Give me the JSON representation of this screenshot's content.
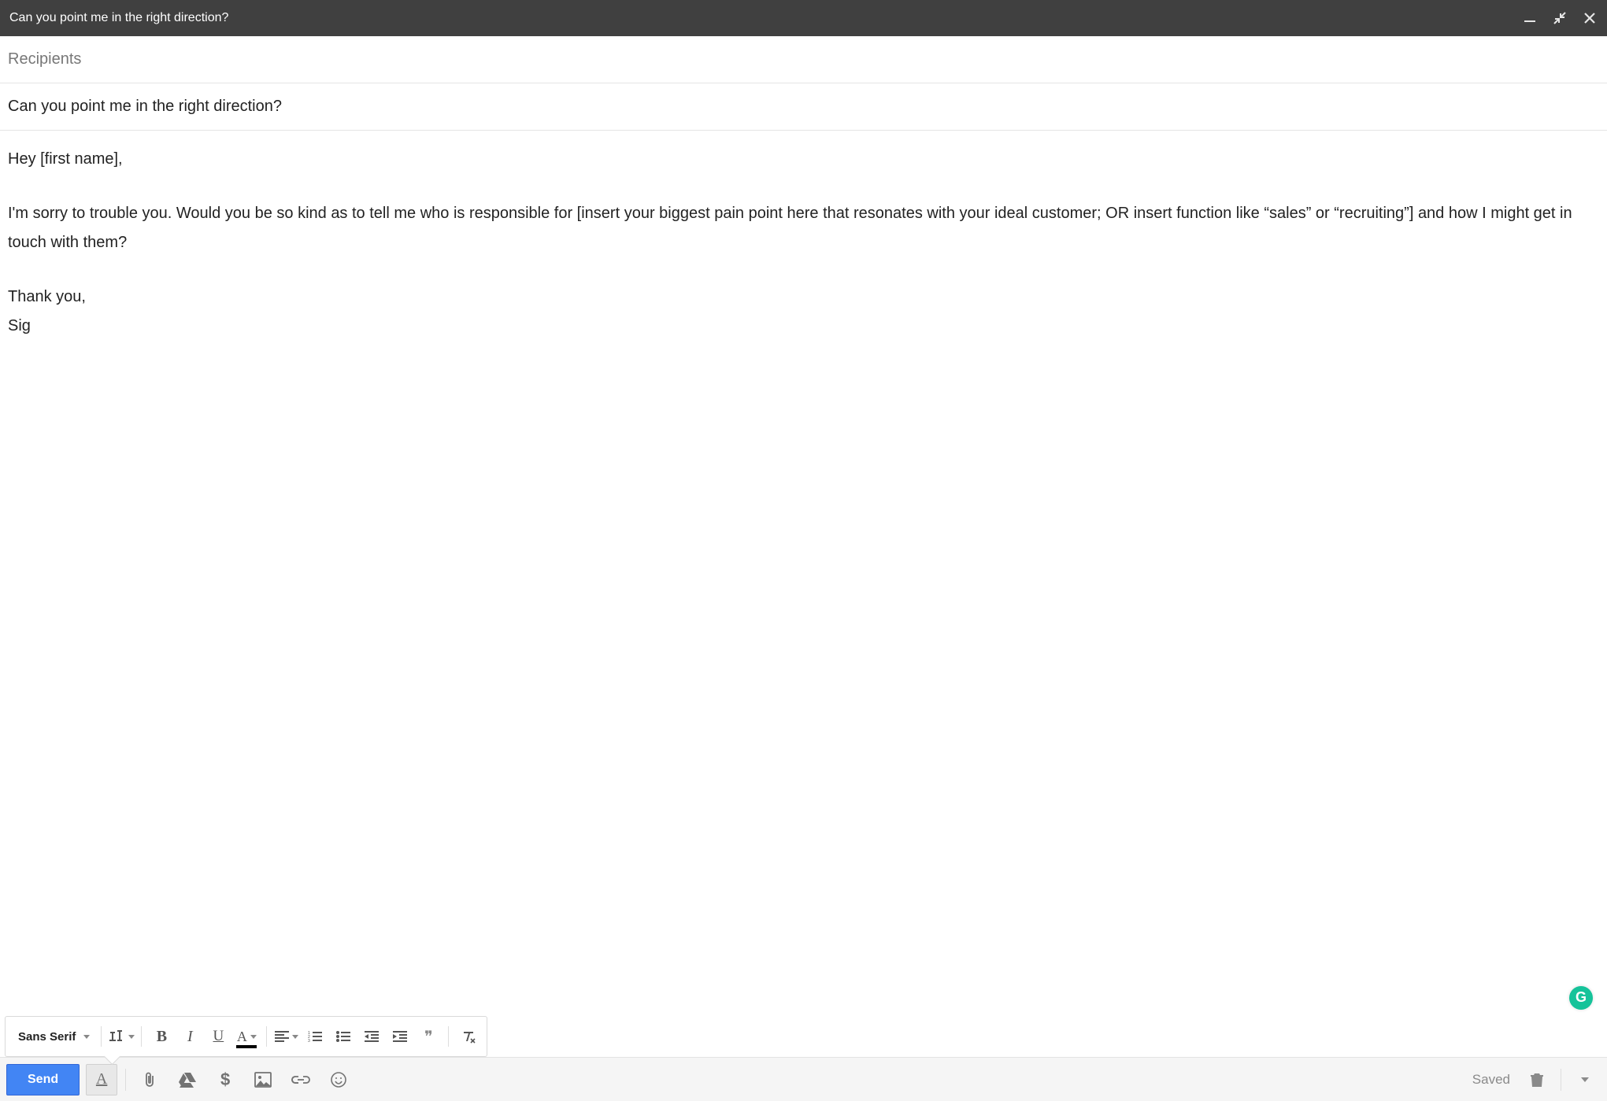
{
  "header": {
    "title": "Can you point me in the right direction?"
  },
  "fields": {
    "recipients_placeholder": "Recipients",
    "subject_value": "Can you point me in the right direction?"
  },
  "body": {
    "line1": "Hey [first name],",
    "line2": "I'm sorry to trouble you. Would you be so kind as to tell me who is responsible for [insert your biggest pain point here that resonates with your ideal customer; OR insert function like “sales” or “recruiting”] and how I might get in touch with them?",
    "line3": "Thank you,",
    "line4": "Sig"
  },
  "format_bar": {
    "font_name": "Sans Serif",
    "bold": "B",
    "italic": "I",
    "underline": "U",
    "textcolor_letter": "A",
    "quote_glyph": "❞"
  },
  "action_bar": {
    "send_label": "Send",
    "format_toggle_letter": "A",
    "saved_label": "Saved"
  },
  "icons": {
    "grammarly_letter": "G",
    "dollar": "$"
  }
}
